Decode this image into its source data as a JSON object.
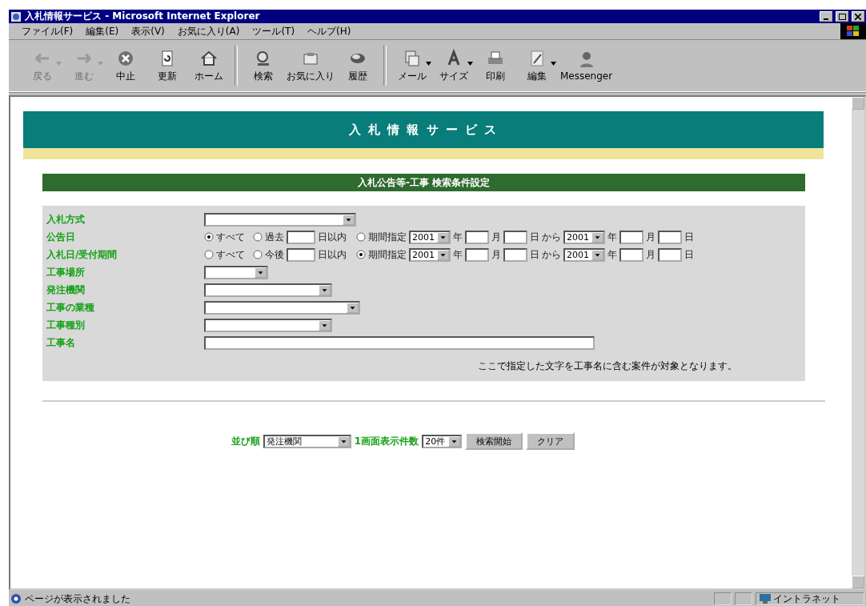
{
  "window": {
    "title": "入札情報サービス - Microsoft Internet Explorer"
  },
  "menu": [
    "ファイル(F)",
    "編集(E)",
    "表示(V)",
    "お気に入り(A)",
    "ツール(T)",
    "ヘルプ(H)"
  ],
  "toolbar": [
    {
      "kind": "back",
      "label": "戻る",
      "disabled": true,
      "dropdown": true
    },
    {
      "kind": "forward",
      "label": "進む",
      "disabled": true,
      "dropdown": true
    },
    {
      "kind": "stop",
      "label": "中止",
      "disabled": false,
      "dropdown": false
    },
    {
      "kind": "refresh",
      "label": "更新",
      "disabled": false,
      "dropdown": false
    },
    {
      "kind": "home",
      "label": "ホーム",
      "disabled": false,
      "dropdown": false
    },
    {
      "kind": "search",
      "label": "検索",
      "disabled": false,
      "dropdown": false
    },
    {
      "kind": "favorites",
      "label": "お気に入り",
      "disabled": false,
      "dropdown": false
    },
    {
      "kind": "history",
      "label": "履歴",
      "disabled": false,
      "dropdown": false
    },
    {
      "kind": "mail",
      "label": "メール",
      "disabled": false,
      "dropdown": true
    },
    {
      "kind": "size",
      "label": "サイズ",
      "disabled": false,
      "dropdown": true
    },
    {
      "kind": "print",
      "label": "印刷",
      "disabled": false,
      "dropdown": false
    },
    {
      "kind": "edit",
      "label": "編集",
      "disabled": false,
      "dropdown": true
    },
    {
      "kind": "messenger",
      "label": "Messenger",
      "disabled": false,
      "dropdown": false
    }
  ],
  "page": {
    "banner": "入 札 情 報 サ ー ビ ス",
    "section_title": "入札公告等-工事 検索条件設定",
    "fields": [
      {
        "kind": "select",
        "label": "入札方式"
      },
      {
        "kind": "date",
        "label": "公告日",
        "radios": [
          {
            "label": "すべて",
            "selected": true
          },
          {
            "label": "過去",
            "selected": false
          },
          {
            "label": "期間指定",
            "selected": false
          }
        ],
        "days_suffix": "日以内",
        "from_year": "2001",
        "to_year": "2001",
        "units": [
          "年",
          "月",
          "日",
          "から",
          "年",
          "月",
          "日"
        ]
      },
      {
        "kind": "date",
        "label": "入札日/受付期間",
        "radios": [
          {
            "label": "すべて",
            "selected": false
          },
          {
            "label": "今後",
            "selected": false
          },
          {
            "label": "期間指定",
            "selected": true
          }
        ],
        "days_suffix": "日以内",
        "from_year": "2001",
        "to_year": "2001",
        "units": [
          "年",
          "月",
          "日",
          "から",
          "年",
          "月",
          "日"
        ]
      },
      {
        "kind": "select",
        "label": "工事場所"
      },
      {
        "kind": "select",
        "label": "発注機関"
      },
      {
        "kind": "select",
        "label": "工事の業種"
      },
      {
        "kind": "select",
        "label": "工事種別"
      },
      {
        "kind": "text",
        "label": "工事名"
      }
    ],
    "note": "ここで指定した文字を工事名に含む案件が対象となります。",
    "sort_label": "並び順",
    "sort_value": "発注機関",
    "per_page_label": "1画面表示件数",
    "per_page_value": "20件",
    "buttons": [
      "検索開始",
      "クリア"
    ]
  },
  "status_bar": {
    "text": "ページが表示されました",
    "zone": "イントラネット"
  }
}
